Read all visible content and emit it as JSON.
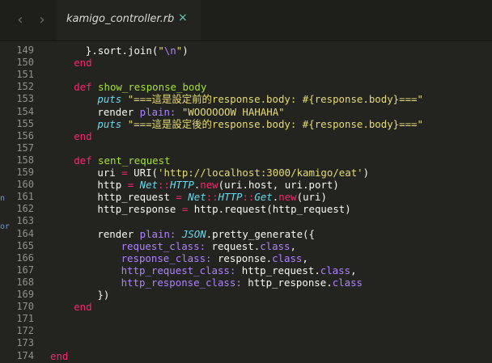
{
  "tabbar": {
    "back_icon": "chevron-left-icon",
    "forward_icon": "chevron-right-icon",
    "tab_title": "kamigo_controller.rb",
    "close_icon": "close-icon",
    "close_glyph": "×"
  },
  "editor": {
    "colors": {
      "background": "#23241f",
      "keyword": "#f92672",
      "function": "#a6e22e",
      "string": "#e6db74",
      "symbol": "#ae81ff",
      "constant": "#66d9ef",
      "text": "#f8f8f2",
      "line_number": "#90918b"
    },
    "edge_fragments": [
      "n",
      "or"
    ],
    "lines": [
      {
        "num": "149",
        "indent": 3,
        "tokens": [
          {
            "t": "}.sort.join(",
            "c": "plain"
          },
          {
            "t": "\"",
            "c": "str"
          },
          {
            "t": "\\n",
            "c": "esc"
          },
          {
            "t": "\"",
            "c": "str"
          },
          {
            "t": ")",
            "c": "plain"
          }
        ]
      },
      {
        "num": "150",
        "indent": 2,
        "tokens": [
          {
            "t": "end",
            "c": "kw"
          }
        ]
      },
      {
        "num": "151",
        "indent": 0,
        "tokens": []
      },
      {
        "num": "152",
        "indent": 2,
        "tokens": [
          {
            "t": "def ",
            "c": "kw"
          },
          {
            "t": "show_response_body",
            "c": "fn"
          }
        ]
      },
      {
        "num": "153",
        "indent": 4,
        "tokens": [
          {
            "t": "puts ",
            "c": "cls"
          },
          {
            "t": "\"===這是設定前的response.body: #{response.body}===\"",
            "c": "str"
          }
        ]
      },
      {
        "num": "154",
        "indent": 4,
        "tokens": [
          {
            "t": "render ",
            "c": "plain"
          },
          {
            "t": "plain: ",
            "c": "sym"
          },
          {
            "t": "\"WOOOOOOW HAHAHA\"",
            "c": "str"
          }
        ]
      },
      {
        "num": "155",
        "indent": 4,
        "tokens": [
          {
            "t": "puts ",
            "c": "cls"
          },
          {
            "t": "\"===這是設定後的response.body: #{response.body}===\"",
            "c": "str"
          }
        ]
      },
      {
        "num": "156",
        "indent": 2,
        "tokens": [
          {
            "t": "end",
            "c": "kw"
          }
        ]
      },
      {
        "num": "157",
        "indent": 0,
        "tokens": []
      },
      {
        "num": "158",
        "indent": 2,
        "tokens": [
          {
            "t": "def ",
            "c": "kw"
          },
          {
            "t": "sent_request",
            "c": "fn"
          }
        ]
      },
      {
        "num": "159",
        "indent": 4,
        "tokens": [
          {
            "t": "uri ",
            "c": "plain"
          },
          {
            "t": "= ",
            "c": "kw"
          },
          {
            "t": "URI(",
            "c": "plain"
          },
          {
            "t": "'http://localhost:3000/kamigo/eat'",
            "c": "str"
          },
          {
            "t": ")",
            "c": "plain"
          }
        ]
      },
      {
        "num": "160",
        "indent": 4,
        "tokens": [
          {
            "t": "http ",
            "c": "plain"
          },
          {
            "t": "= ",
            "c": "kw"
          },
          {
            "t": "Net",
            "c": "cls"
          },
          {
            "t": "::",
            "c": "kw"
          },
          {
            "t": "HTTP",
            "c": "cls"
          },
          {
            "t": ".",
            "c": "plain"
          },
          {
            "t": "new",
            "c": "kw"
          },
          {
            "t": "(uri.host, uri.port)",
            "c": "plain"
          }
        ]
      },
      {
        "num": "161",
        "indent": 4,
        "tokens": [
          {
            "t": "http_request ",
            "c": "plain"
          },
          {
            "t": "= ",
            "c": "kw"
          },
          {
            "t": "Net",
            "c": "cls"
          },
          {
            "t": "::",
            "c": "kw"
          },
          {
            "t": "HTTP",
            "c": "cls"
          },
          {
            "t": "::",
            "c": "kw"
          },
          {
            "t": "Get",
            "c": "cls"
          },
          {
            "t": ".",
            "c": "plain"
          },
          {
            "t": "new",
            "c": "kw"
          },
          {
            "t": "(uri)",
            "c": "plain"
          }
        ]
      },
      {
        "num": "162",
        "indent": 4,
        "tokens": [
          {
            "t": "http_response ",
            "c": "plain"
          },
          {
            "t": "= ",
            "c": "kw"
          },
          {
            "t": "http.request(http_request)",
            "c": "plain"
          }
        ]
      },
      {
        "num": "163",
        "indent": 0,
        "tokens": []
      },
      {
        "num": "164",
        "indent": 4,
        "tokens": [
          {
            "t": "render ",
            "c": "plain"
          },
          {
            "t": "plain: ",
            "c": "sym"
          },
          {
            "t": "JSON",
            "c": "cls"
          },
          {
            "t": ".pretty_generate({",
            "c": "plain"
          }
        ]
      },
      {
        "num": "165",
        "indent": 6,
        "tokens": [
          {
            "t": "request_class: ",
            "c": "sym"
          },
          {
            "t": "request.",
            "c": "plain"
          },
          {
            "t": "class",
            "c": "sym"
          },
          {
            "t": ",",
            "c": "plain"
          }
        ]
      },
      {
        "num": "166",
        "indent": 6,
        "tokens": [
          {
            "t": "response_class: ",
            "c": "sym"
          },
          {
            "t": "response.",
            "c": "plain"
          },
          {
            "t": "class",
            "c": "sym"
          },
          {
            "t": ",",
            "c": "plain"
          }
        ]
      },
      {
        "num": "167",
        "indent": 6,
        "tokens": [
          {
            "t": "http_request_class: ",
            "c": "sym"
          },
          {
            "t": "http_request.",
            "c": "plain"
          },
          {
            "t": "class",
            "c": "sym"
          },
          {
            "t": ",",
            "c": "plain"
          }
        ]
      },
      {
        "num": "168",
        "indent": 6,
        "tokens": [
          {
            "t": "http_response_class: ",
            "c": "sym"
          },
          {
            "t": "http_response.",
            "c": "plain"
          },
          {
            "t": "class",
            "c": "sym"
          }
        ]
      },
      {
        "num": "169",
        "indent": 4,
        "tokens": [
          {
            "t": "})",
            "c": "plain"
          }
        ]
      },
      {
        "num": "170",
        "indent": 2,
        "tokens": [
          {
            "t": "end",
            "c": "kw"
          }
        ]
      },
      {
        "num": "171",
        "indent": 0,
        "tokens": []
      },
      {
        "num": "172",
        "indent": 0,
        "tokens": []
      },
      {
        "num": "173",
        "indent": 0,
        "tokens": []
      },
      {
        "num": "174",
        "indent": 0,
        "tokens": [
          {
            "t": "end",
            "c": "kw"
          }
        ]
      }
    ]
  }
}
